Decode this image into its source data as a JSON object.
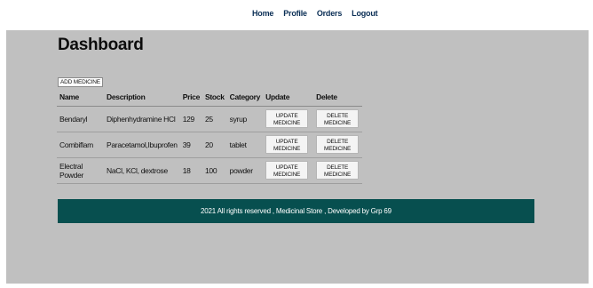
{
  "nav": {
    "links": [
      "Home",
      "Profile",
      "Orders",
      "Logout"
    ]
  },
  "page_title": "Dashboard",
  "add_medicine_label": "ADD MEDICINE",
  "table": {
    "headers": [
      "Name",
      "Description",
      "Price",
      "Stock",
      "Category",
      "Update",
      "Delete"
    ],
    "rows": [
      {
        "name": "Bendaryl",
        "description": "Diphenhydramine HCl",
        "price": "129",
        "stock": "25",
        "category": "syrup",
        "update_label": "UPDATE MEDICINE",
        "delete_label": "DELETE MEDICINE"
      },
      {
        "name": "Combiflam",
        "description": "Paracetamol,Ibuprofen",
        "price": "39",
        "stock": "20",
        "category": "tablet",
        "update_label": "UPDATE MEDICINE",
        "delete_label": "DELETE MEDICINE"
      },
      {
        "name": "Electral Powder",
        "description": "NaCl, KCl, dextrose",
        "price": "18",
        "stock": "100",
        "category": "powder",
        "update_label": "UPDATE MEDICINE",
        "delete_label": "DELETE MEDICINE"
      }
    ]
  },
  "footer_text": "2021 All rights reserved , Medicinal Store , Developed by Grp 69",
  "colors": {
    "nav_link": "#0a2e55",
    "main_bg": "#c0c0c0",
    "footer_bg": "#074f4f"
  }
}
